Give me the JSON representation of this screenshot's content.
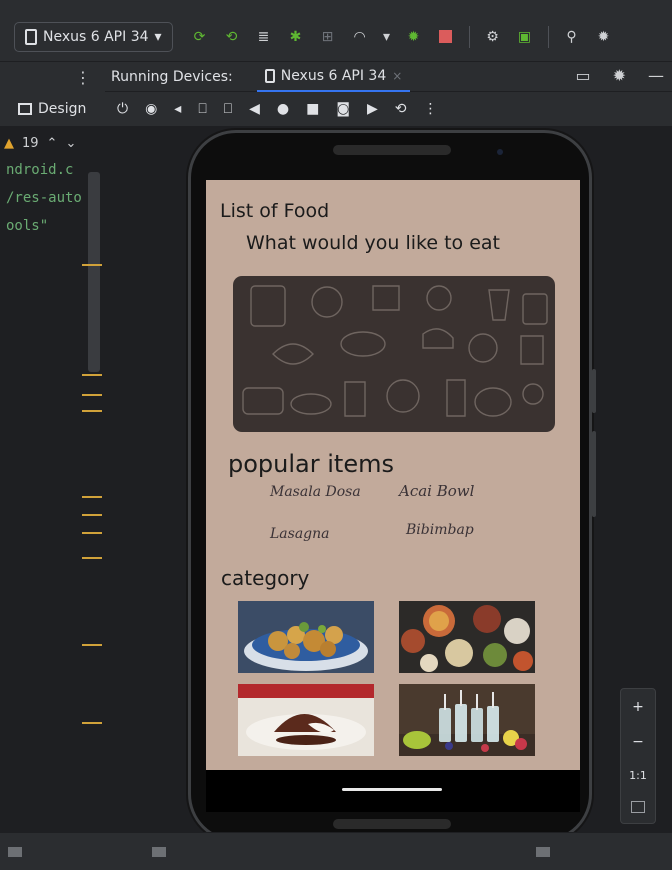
{
  "toolbar": {
    "device_selector": "Nexus 6 API 34",
    "device_dropdown": "▾",
    "icons": [
      "apply-changes-icon",
      "apply-code-changes-icon",
      "logcat-icon",
      "debug-app-icon",
      "attach-debugger-icon",
      "profile-icon",
      "dropdown-icon",
      "run-icon",
      "stop-icon",
      "device-manager-icon",
      "sdk-manager-icon",
      "search-icon",
      "settings-icon"
    ]
  },
  "editor": {
    "menu": "⋮",
    "design_label": "Design",
    "warning_count": "19",
    "code_lines": [
      "ndroid.c",
      "/res-auto",
      "ools\""
    ]
  },
  "running_devices": {
    "panel_title": "Running Devices:",
    "tab_label": "Nexus 6 API 34",
    "tab_close": "×",
    "controls": [
      "power-icon",
      "volume-up-icon",
      "volume-down-icon",
      "rotate-left-icon",
      "rotate-right-icon",
      "back-icon",
      "home-icon",
      "overview-icon",
      "screenshot-icon",
      "screen-record-icon",
      "snapshot-icon",
      "more-icon"
    ]
  },
  "app": {
    "title": "List of Food",
    "subtitle": "What would you like to eat",
    "popular_heading": "popular items",
    "popular_items": [
      "Masala Dosa",
      "Acai Bowl",
      "Lasagna",
      "Bibimbap"
    ],
    "category_heading": "category",
    "category_images": [
      "fried-snacks-image",
      "pizza-spread-image",
      "chocolate-dessert-image",
      "drinks-image"
    ]
  },
  "zoom": {
    "plus": "+",
    "minus": "−",
    "one_to_one": "1:1"
  },
  "colors": {
    "screen_bg": "#c2aa9b",
    "banner_bg": "#3a3230",
    "accent_blue": "#3574f0",
    "run_red": "#db5c5c",
    "run_green": "#5fb832",
    "warning": "#e0a32e"
  }
}
